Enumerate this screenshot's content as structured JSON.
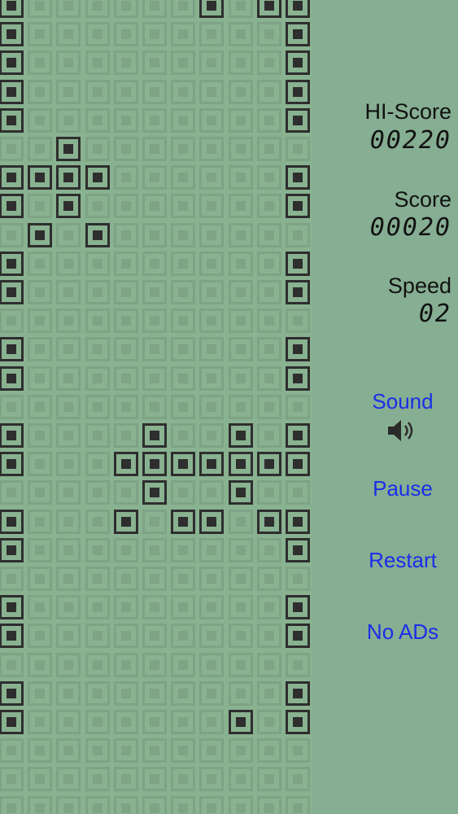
{
  "board": {
    "columns": 11,
    "rows": 29,
    "lit_cells": [
      [
        0,
        0
      ],
      [
        7,
        0
      ],
      [
        9,
        0
      ],
      [
        10,
        0
      ],
      [
        0,
        1
      ],
      [
        10,
        1
      ],
      [
        0,
        2
      ],
      [
        10,
        2
      ],
      [
        0,
        3
      ],
      [
        10,
        3
      ],
      [
        0,
        4
      ],
      [
        10,
        4
      ],
      [
        2,
        5
      ],
      [
        0,
        6
      ],
      [
        1,
        6
      ],
      [
        2,
        6
      ],
      [
        3,
        6
      ],
      [
        10,
        6
      ],
      [
        0,
        7
      ],
      [
        2,
        7
      ],
      [
        10,
        7
      ],
      [
        1,
        8
      ],
      [
        3,
        8
      ],
      [
        0,
        9
      ],
      [
        10,
        9
      ],
      [
        0,
        10
      ],
      [
        10,
        10
      ],
      [
        0,
        12
      ],
      [
        10,
        12
      ],
      [
        0,
        13
      ],
      [
        10,
        13
      ],
      [
        0,
        15
      ],
      [
        5,
        15
      ],
      [
        8,
        15
      ],
      [
        10,
        15
      ],
      [
        0,
        16
      ],
      [
        4,
        16
      ],
      [
        5,
        16
      ],
      [
        6,
        16
      ],
      [
        7,
        16
      ],
      [
        8,
        16
      ],
      [
        9,
        16
      ],
      [
        10,
        16
      ],
      [
        5,
        17
      ],
      [
        8,
        17
      ],
      [
        0,
        18
      ],
      [
        4,
        18
      ],
      [
        6,
        18
      ],
      [
        7,
        18
      ],
      [
        9,
        18
      ],
      [
        10,
        18
      ],
      [
        0,
        19
      ],
      [
        10,
        19
      ],
      [
        0,
        21
      ],
      [
        10,
        21
      ],
      [
        0,
        22
      ],
      [
        10,
        22
      ],
      [
        0,
        24
      ],
      [
        10,
        24
      ],
      [
        0,
        25
      ],
      [
        8,
        25
      ],
      [
        10,
        25
      ]
    ]
  },
  "stats": {
    "hi_score_label": "HI-Score",
    "hi_score_value": "00220",
    "score_label": "Score",
    "score_value": "00020",
    "speed_label": "Speed",
    "speed_value": "02"
  },
  "controls": {
    "sound_label": "Sound",
    "sound_icon": "speaker-icon",
    "pause_label": "Pause",
    "restart_label": "Restart",
    "no_ads_label": "No ADs"
  },
  "colors": {
    "background": "#86ae92",
    "lit_cell": "#2e2e2e",
    "unlit_cell": "#7ea385",
    "button_text": "#1b2ee8"
  }
}
